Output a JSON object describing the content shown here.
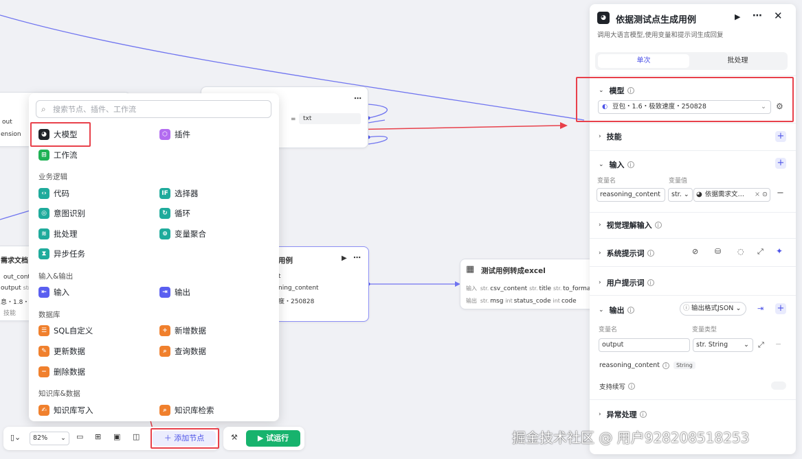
{
  "menu": {
    "search_placeholder": "搜索节点、插件、工作流",
    "top_items": {
      "llm": "大模型",
      "plugin": "插件",
      "workflow": "工作流"
    },
    "sections": {
      "logic": "业务逻辑",
      "io": "输入&输出",
      "db": "数据库",
      "kb": "知识库&数据"
    },
    "logic_items": {
      "code": "代码",
      "selector": "选择器",
      "intent": "意图识别",
      "loop": "循环",
      "batch": "批处理",
      "var_agg": "变量聚合",
      "async": "异步任务"
    },
    "io_items": {
      "input": "输入",
      "output": "输出"
    },
    "db_items": {
      "sql": "SQL自定义",
      "add": "新增数据",
      "update": "更新数据",
      "query": "查询数据",
      "delete": "删除数据"
    },
    "kb_items": {
      "write": "知识库写入",
      "search": "知识库检索"
    }
  },
  "canvas": {
    "node_left_top": {
      "row1": "out",
      "row2": "ension"
    },
    "node_mid_top": {
      "op": "=",
      "value": "txt"
    },
    "node_left": {
      "title": "需求文档",
      "r1a": "out_conten",
      "r2a": "output",
      "r2b": "str. r",
      "r3": "息・1.8・深",
      "r4": "技能"
    },
    "node_center": {
      "title": "用例",
      "r1": "t",
      "r2": "ning_content",
      "r3": "度・250828"
    },
    "node_excel": {
      "title": "测试用例转成excel",
      "in_label": "输入",
      "in1": "csv_content",
      "in2": "title",
      "in3": "to_format",
      "out_label": "输出",
      "out1": "msg",
      "out2": "status_code",
      "out3": "code",
      "t_str": "str.",
      "t_int": "int"
    }
  },
  "panel": {
    "title": "依据测试点生成用例",
    "subtitle": "调用大语言模型,使用变量和提示词生成回复",
    "tab_single": "单次",
    "tab_batch": "批处理",
    "model_section": "模型",
    "model_value": "豆包・1.6・极致速度・250828",
    "skills": "技能",
    "input": "输入",
    "var_name_label": "变量名",
    "var_value_label": "变量值",
    "input_var_name": "reasoning_content",
    "input_type": "str.",
    "input_ref": "依据需求文…",
    "vision_input": "视觉理解输入",
    "system_prompt": "系统提示词",
    "user_prompt": "用户提示词",
    "output": "输出",
    "output_format": "输出格式JSON",
    "var_type_label": "变量类型",
    "output_var_name": "output",
    "output_type": "str. String",
    "reasoning_label": "reasoning_content",
    "reasoning_type": "String",
    "continue_write": "支持续写",
    "error_handling": "异常处理"
  },
  "toolbar": {
    "zoom": "82%",
    "add_node": "添加节点",
    "run": "试运行"
  },
  "watermark": "掘金技术社区 @ 用户928208518253",
  "colors": {
    "accent": "#4d53e8",
    "highlight_red": "#e8404a",
    "run_green": "#17b36d"
  }
}
